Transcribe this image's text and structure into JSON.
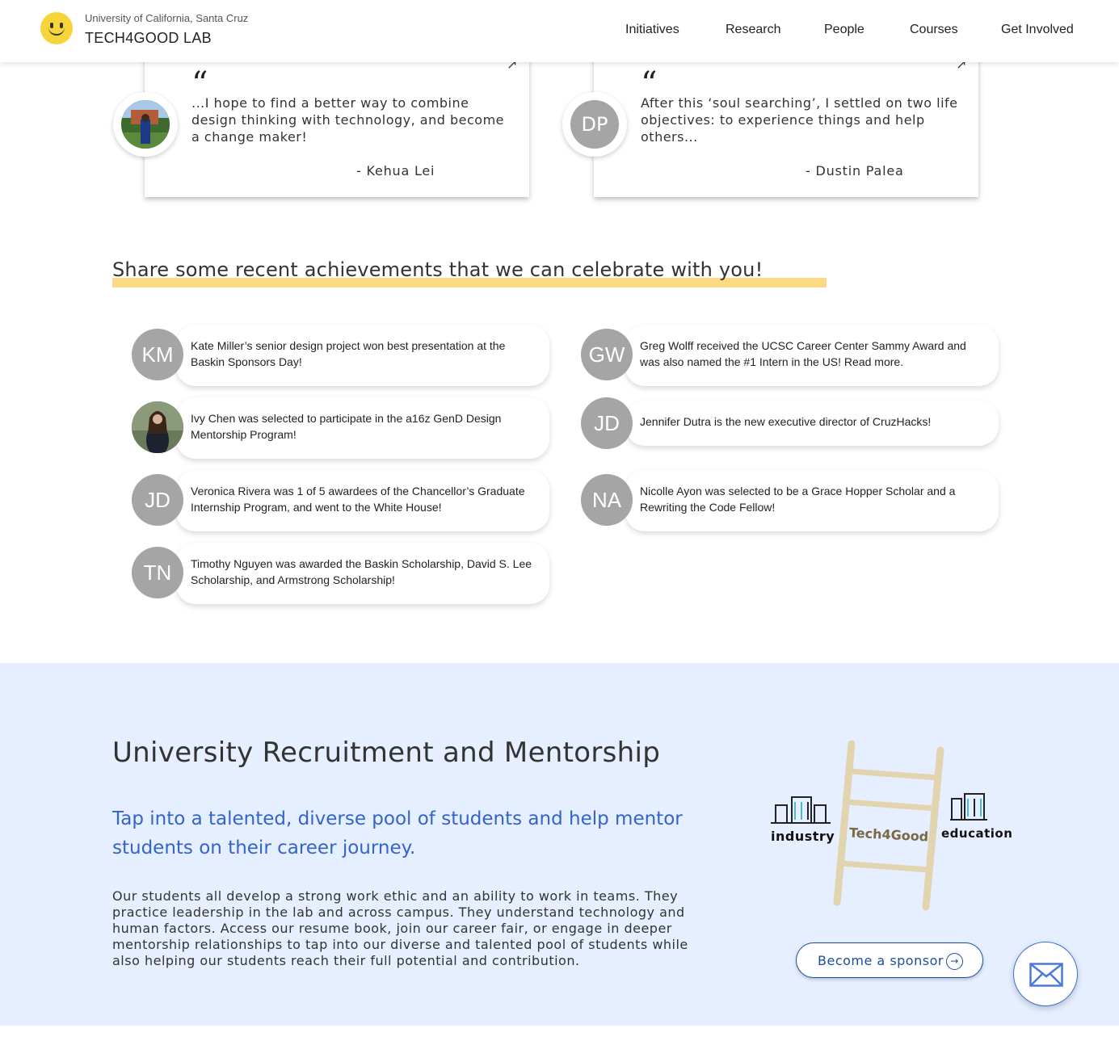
{
  "header": {
    "university": "University of California, Santa Cruz",
    "lab_name": "TECH4GOOD LAB",
    "nav": [
      "Initiatives",
      "Research",
      "People",
      "Courses",
      "Get Involved"
    ]
  },
  "quotes": [
    {
      "mark": "“",
      "text": "...I hope to find a better way to combine design thinking with technology, and become a change maker!",
      "author": "-  Kehua Lei",
      "avatar": "photo"
    },
    {
      "mark": "“",
      "text": "After this ‘soul searching’, I settled on two life objectives: to experience things and help others...",
      "author": "-  Dustin Palea",
      "avatar": "DP"
    }
  ],
  "achievements": {
    "title": "Share some recent achievements that we can celebrate with you!",
    "items": [
      {
        "initials": "KM",
        "text": "Kate Miller’s senior design project won best presentation at the Baskin Sponsors Day!"
      },
      {
        "initials": "GW",
        "text": "Greg Wolff received the UCSC Career Center Sammy Award and was also named the #1 Intern in the US! Read more."
      },
      {
        "initials": "",
        "text": "Ivy Chen was selected to participate in the a16z GenD Design Mentorship Program!"
      },
      {
        "initials": "JD",
        "text": "Jennifer Dutra is the new executive director of CruzHacks!"
      },
      {
        "initials": "JD",
        "text": "Veronica Rivera was 1 of 5 awardees of the Chancellor’s Graduate Internship Program, and went to the White House!"
      },
      {
        "initials": "NA",
        "text": "Nicolle Ayon was selected to be a Grace Hopper Scholar and a Rewriting the Code Fellow!"
      },
      {
        "initials": "TN",
        "text": "Timothy Nguyen was awarded the Baskin Scholarship, David S. Lee Scholarship, and Armstrong Scholarship!"
      }
    ]
  },
  "recruitment": {
    "title": "University Recruitment and Mentorship",
    "subtitle": "Tap into a talented, diverse pool of students and help mentor students on their career journey.",
    "body": "Our students all develop a strong work ethic and an ability to work in teams. They practice leadership in the lab and across campus. They understand technology and human factors. Access our resume book, join our career fair, or engage in deeper mentorship relationships to tap into our diverse and talented pool of students while also helping our students reach their full potential and contribution.",
    "illustration": {
      "left_label": "industry",
      "center_label": "Tech4Good",
      "right_label": "education"
    },
    "sponsor_button": "Become a sponsor",
    "mail_icon": "envelope-icon"
  },
  "colors": {
    "accent_yellow": "#fcd984",
    "blue_text": "#3464c8",
    "section_bg": "#e5efff",
    "avatar_gray": "#a5a5a5",
    "button_blue": "#1a4f99"
  }
}
